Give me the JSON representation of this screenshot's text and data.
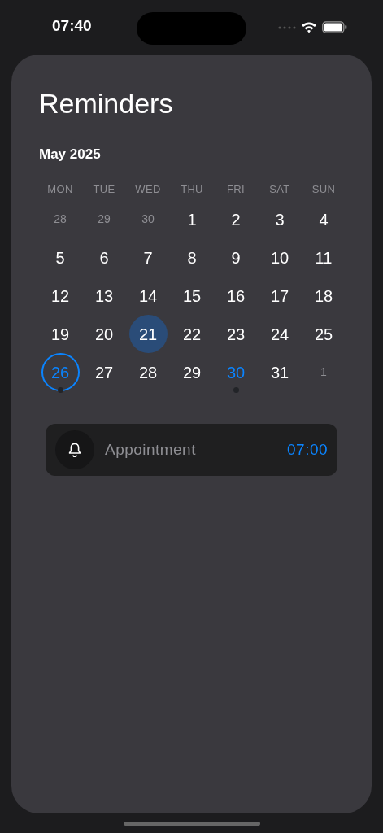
{
  "status_bar": {
    "time": "07:40"
  },
  "title": "Reminders",
  "month": "May 2025",
  "weekdays": [
    "MON",
    "TUE",
    "WED",
    "THU",
    "FRI",
    "SAT",
    "SUN"
  ],
  "days": [
    {
      "label": "28",
      "kind": "outside",
      "selected": false,
      "today": false,
      "event": false,
      "accent": false
    },
    {
      "label": "29",
      "kind": "outside",
      "selected": false,
      "today": false,
      "event": false,
      "accent": false
    },
    {
      "label": "30",
      "kind": "outside",
      "selected": false,
      "today": false,
      "event": false,
      "accent": false
    },
    {
      "label": "1",
      "kind": "normal",
      "selected": false,
      "today": false,
      "event": false,
      "accent": false
    },
    {
      "label": "2",
      "kind": "normal",
      "selected": false,
      "today": false,
      "event": false,
      "accent": false
    },
    {
      "label": "3",
      "kind": "normal",
      "selected": false,
      "today": false,
      "event": false,
      "accent": false
    },
    {
      "label": "4",
      "kind": "normal",
      "selected": false,
      "today": false,
      "event": false,
      "accent": false
    },
    {
      "label": "5",
      "kind": "normal",
      "selected": false,
      "today": false,
      "event": false,
      "accent": false
    },
    {
      "label": "6",
      "kind": "normal",
      "selected": false,
      "today": false,
      "event": false,
      "accent": false
    },
    {
      "label": "7",
      "kind": "normal",
      "selected": false,
      "today": false,
      "event": false,
      "accent": false
    },
    {
      "label": "8",
      "kind": "normal",
      "selected": false,
      "today": false,
      "event": false,
      "accent": false
    },
    {
      "label": "9",
      "kind": "normal",
      "selected": false,
      "today": false,
      "event": false,
      "accent": false
    },
    {
      "label": "10",
      "kind": "normal",
      "selected": false,
      "today": false,
      "event": false,
      "accent": false
    },
    {
      "label": "11",
      "kind": "normal",
      "selected": false,
      "today": false,
      "event": false,
      "accent": false
    },
    {
      "label": "12",
      "kind": "normal",
      "selected": false,
      "today": false,
      "event": false,
      "accent": false
    },
    {
      "label": "13",
      "kind": "normal",
      "selected": false,
      "today": false,
      "event": false,
      "accent": false
    },
    {
      "label": "14",
      "kind": "normal",
      "selected": false,
      "today": false,
      "event": false,
      "accent": false
    },
    {
      "label": "15",
      "kind": "normal",
      "selected": false,
      "today": false,
      "event": false,
      "accent": false
    },
    {
      "label": "16",
      "kind": "normal",
      "selected": false,
      "today": false,
      "event": false,
      "accent": false
    },
    {
      "label": "17",
      "kind": "normal",
      "selected": false,
      "today": false,
      "event": false,
      "accent": false
    },
    {
      "label": "18",
      "kind": "normal",
      "selected": false,
      "today": false,
      "event": false,
      "accent": false
    },
    {
      "label": "19",
      "kind": "normal",
      "selected": false,
      "today": false,
      "event": false,
      "accent": false
    },
    {
      "label": "20",
      "kind": "normal",
      "selected": false,
      "today": false,
      "event": false,
      "accent": false
    },
    {
      "label": "21",
      "kind": "normal",
      "selected": true,
      "today": false,
      "event": false,
      "accent": false
    },
    {
      "label": "22",
      "kind": "normal",
      "selected": false,
      "today": false,
      "event": false,
      "accent": false
    },
    {
      "label": "23",
      "kind": "normal",
      "selected": false,
      "today": false,
      "event": false,
      "accent": false
    },
    {
      "label": "24",
      "kind": "normal",
      "selected": false,
      "today": false,
      "event": false,
      "accent": false
    },
    {
      "label": "25",
      "kind": "normal",
      "selected": false,
      "today": false,
      "event": false,
      "accent": false
    },
    {
      "label": "26",
      "kind": "normal",
      "selected": false,
      "today": true,
      "event": true,
      "accent": true
    },
    {
      "label": "27",
      "kind": "normal",
      "selected": false,
      "today": false,
      "event": false,
      "accent": false
    },
    {
      "label": "28",
      "kind": "normal",
      "selected": false,
      "today": false,
      "event": false,
      "accent": false
    },
    {
      "label": "29",
      "kind": "normal",
      "selected": false,
      "today": false,
      "event": false,
      "accent": false
    },
    {
      "label": "30",
      "kind": "normal",
      "selected": false,
      "today": false,
      "event": true,
      "accent": true
    },
    {
      "label": "31",
      "kind": "normal",
      "selected": false,
      "today": false,
      "event": false,
      "accent": false
    },
    {
      "label": "1",
      "kind": "outside",
      "selected": false,
      "today": false,
      "event": false,
      "accent": false
    }
  ],
  "reminders": [
    {
      "title": "Appointment",
      "time": "07:00"
    }
  ]
}
